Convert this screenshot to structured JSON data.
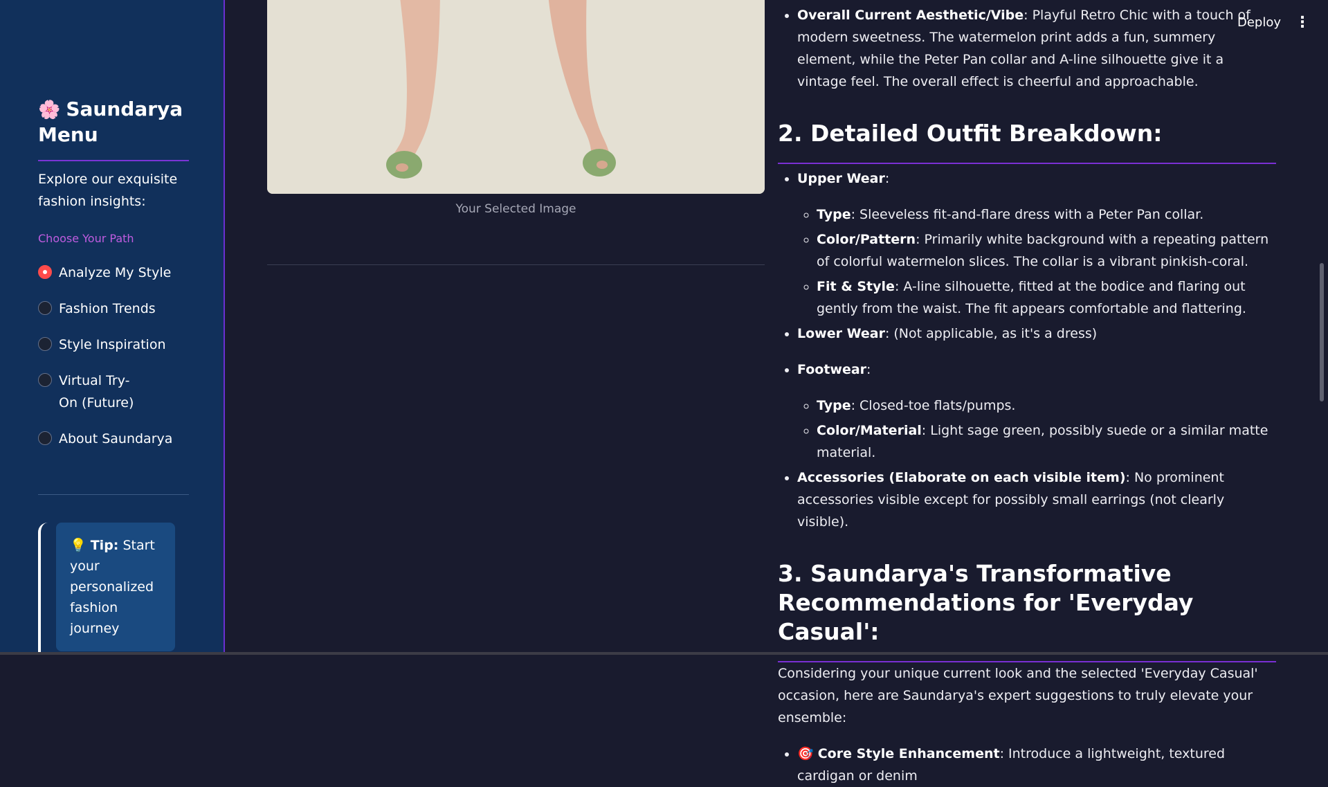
{
  "sidebar": {
    "flower_icon": "🌸",
    "title": "Saundarya Menu",
    "explore_text": "Explore our exquisite fashion insights:",
    "path_label": "Choose Your Path",
    "options": [
      {
        "label": "Analyze My Style",
        "selected": true
      },
      {
        "label": "Fashion Trends",
        "selected": false
      },
      {
        "label": "Style Inspiration",
        "selected": false
      },
      {
        "label": "Virtual Try-On (Future)",
        "selected": false
      },
      {
        "label": "About Saundarya",
        "selected": false
      }
    ],
    "tip_icon": "💡",
    "tip_bold": "Tip:",
    "tip_text": "Start your personalized fashion journey"
  },
  "topbar": {
    "deploy_label": "Deploy",
    "menu_icon": "⋮"
  },
  "image_caption": "Your Selected Image",
  "analysis": {
    "vibe_label": "Overall Current Aesthetic/Vibe",
    "vibe_text": ": Playful Retro Chic with a touch of modern sweetness. The watermelon print adds a fun, summery element, while the Peter Pan collar and A-line silhouette give it a vintage feel. The overall effect is cheerful and approachable.",
    "section2_title": "2. Detailed Outfit Breakdown:",
    "upper_wear_label": "Upper Wear",
    "upper_type_label": "Type",
    "upper_type_text": ": Sleeveless fit-and-flare dress with a Peter Pan collar.",
    "upper_color_label": "Color/Pattern",
    "upper_color_text": ": Primarily white background with a repeating pattern of colorful watermelon slices. The collar is a vibrant pinkish-coral.",
    "upper_fit_label": "Fit & Style",
    "upper_fit_text": ": A-line silhouette, fitted at the bodice and flaring out gently from the waist. The fit appears comfortable and flattering.",
    "lower_wear_label": "Lower Wear",
    "lower_wear_text": ": (Not applicable, as it's a dress)",
    "footwear_label": "Footwear",
    "foot_type_label": "Type",
    "foot_type_text": ": Closed-toe flats/pumps.",
    "foot_color_label": "Color/Material",
    "foot_color_text": ": Light sage green, possibly suede or a similar matte material.",
    "accessories_label": "Accessories (Elaborate on each visible item)",
    "accessories_text": ": No prominent accessories visible except for possibly small earrings (not clearly visible).",
    "section3_title": "3. Saundarya's Transformative Recommendations for 'Everyday Casual':",
    "section3_intro": "Considering your unique current look and the selected 'Everyday Casual' occasion, here are Saundarya's expert suggestions to truly elevate your ensemble:",
    "core_icon": "🎯",
    "core_label": "Core Style Enhancement",
    "core_text": ": Introduce a lightweight, textured cardigan or denim"
  },
  "colors": {
    "sidebar_bg": "#11305b",
    "main_bg": "#191b2e",
    "accent_purple": "#7a2fd4",
    "radio_selected": "#ff4b4b",
    "path_label": "#c05ce0"
  }
}
